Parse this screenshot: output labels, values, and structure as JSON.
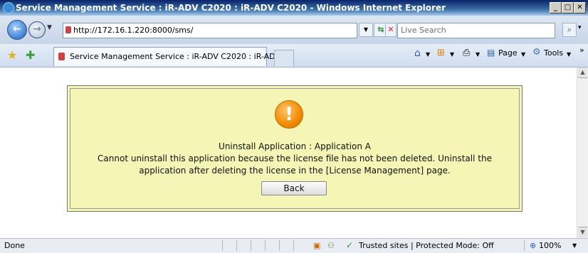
{
  "window": {
    "title": "Service Management Service : iR-ADV C2020 : iR-ADV C2020 - Windows Internet Explorer"
  },
  "address_bar": {
    "url": "http://172.16.1.220:8000/sms/",
    "search_placeholder": "Live Search"
  },
  "tabs": [
    {
      "label": "Service Management Service : iR-ADV C2020 : iR-ADV..."
    }
  ],
  "command_bar": {
    "page_label": "Page",
    "tools_label": "Tools"
  },
  "dialog": {
    "heading": "Uninstall Application : Application A",
    "message_line1": "Cannot uninstall this application because the license file has not been deleted. Uninstall the",
    "message_line2": "application after deleting the license in the [License Management] page.",
    "back_label": "Back",
    "icon": "warning-icon",
    "panel_color": "#f5f5b6"
  },
  "status_bar": {
    "status": "Done",
    "zone": "Trusted sites | Protected Mode: Off",
    "zoom": "100%"
  }
}
